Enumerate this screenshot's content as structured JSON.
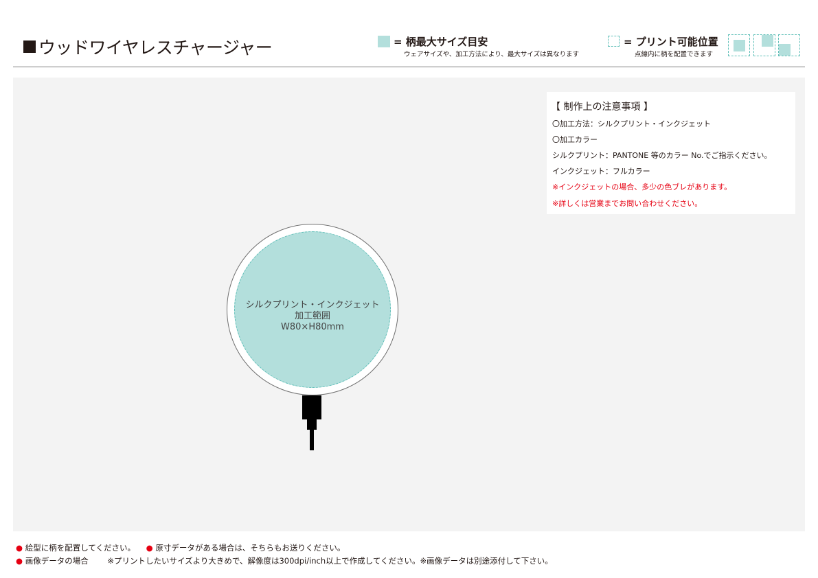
{
  "header": {
    "title_mark": "■",
    "title": "ウッドワイヤレスチャージャー"
  },
  "legend_max": {
    "heading": "= 柄最大サイズ目安",
    "sub": "ウェアサイズや、加工方法により、最大サイズは異なります"
  },
  "legend_print": {
    "heading": "= プリント可能位置",
    "sub": "点線内に柄を配置できます"
  },
  "notes": {
    "title": "【 制作上の注意事項 】",
    "lines": [
      "〇加工方法：シルクプリント・インクジェット",
      "〇加工カラー",
      "シルクプリント：PANTONE 等のカラー No.でご指示ください。",
      "インクジェット：フルカラー"
    ],
    "warnings": [
      "※インクジェットの場合、多少の色ブレがあります。",
      "※詳しくは営業までお問い合わせください。"
    ]
  },
  "print_area": {
    "method": "シルクプリント・インクジェット",
    "label": "加工範囲",
    "size": "W80×H80mm"
  },
  "footer": {
    "bullet": "●",
    "item1": "絵型に柄を配置してください。",
    "item2": "原寸データがある場合は、そちらもお送りください。",
    "item3": "画像データの場合",
    "item4": "※プリントしたいサイズより大きめで、解像度は300dpi/inch以上で作成してください。※画像データは別途添付して下さい。"
  },
  "colors": {
    "print_area_fill": "#b3dfdc",
    "dashed_outline": "#5fbfb8",
    "warning_red": "#e60012",
    "canvas_bg": "#f3f3f3"
  }
}
